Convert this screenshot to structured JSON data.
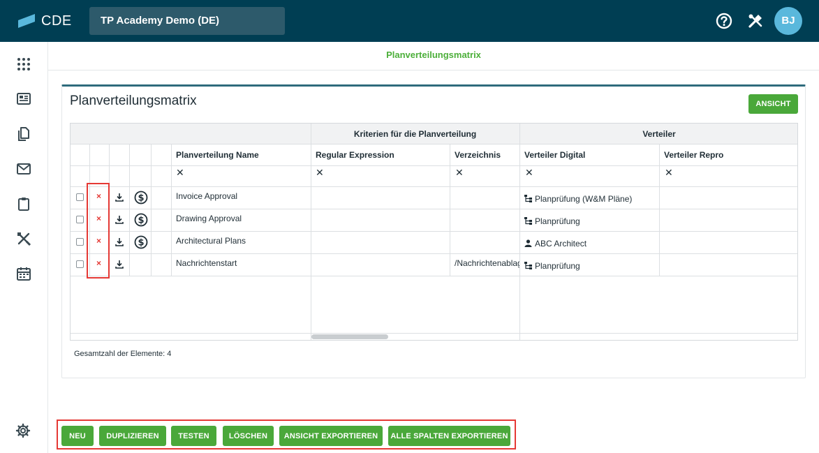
{
  "topbar": {
    "logo_text": "CDE",
    "project_name": "TP Academy Demo (DE)",
    "avatar_initials": "BJ"
  },
  "subheader": {
    "title": "Planverteilungsmatrix"
  },
  "panel": {
    "title": "Planverteilungsmatrix",
    "view_button": "ANSICHT"
  },
  "grid": {
    "groups": {
      "criteria": "Kriterien für die Planverteilung",
      "distributor": "Verteiler"
    },
    "columns": {
      "name": "Planverteilung Name",
      "regex": "Regular Expression",
      "directory": "Verzeichnis",
      "dist_digital": "Verteiler Digital",
      "dist_repro": "Verteiler Repro"
    },
    "filter_clear": "✕",
    "row_delete_mark": "×",
    "rows": [
      {
        "name": "Invoice Approval",
        "regex": "",
        "directory": "",
        "dist_digital": "Planprüfung (W&M Pläne)",
        "dist_digital_icon": "org-chart-icon",
        "dist_repro": "",
        "has_dollar": true
      },
      {
        "name": "Drawing Approval",
        "regex": "",
        "directory": "",
        "dist_digital": "Planprüfung",
        "dist_digital_icon": "org-chart-icon",
        "dist_repro": "",
        "has_dollar": true
      },
      {
        "name": "Architectural Plans",
        "regex": "",
        "directory": "",
        "dist_digital": "ABC Architect",
        "dist_digital_icon": "person-icon",
        "dist_repro": "",
        "has_dollar": true
      },
      {
        "name": "Nachrichtenstart",
        "regex": "",
        "directory": "/Nachrichtenablag",
        "dist_digital": "Planprüfung",
        "dist_digital_icon": "org-chart-icon",
        "dist_repro": "",
        "has_dollar": false
      }
    ]
  },
  "footer": {
    "total_label": "Gesamtzahl der Elemente: 4"
  },
  "actions": {
    "new": "NEU",
    "duplicate": "DUPLIZIEREN",
    "test": "TESTEN",
    "delete": "LÖSCHEN",
    "export_view": "ANSICHT EXPORTIEREN",
    "export_all": "ALLE SPALTEN EXPORTIEREN"
  },
  "colors": {
    "topbar": "#003e53",
    "accent_green": "#4aa83a",
    "highlight_red": "#e53935",
    "avatar": "#5ab8dc"
  }
}
